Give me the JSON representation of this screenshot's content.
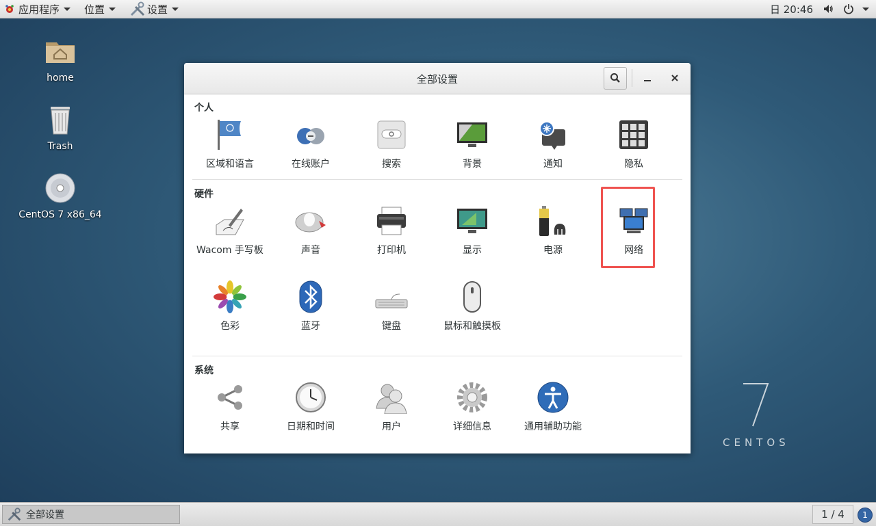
{
  "topbar": {
    "apps_label": "应用程序",
    "places_label": "位置",
    "settings_label": "设置",
    "clock": "日 20:46"
  },
  "desktop": {
    "icons": [
      {
        "label": "home"
      },
      {
        "label": "Trash"
      },
      {
        "label": "CentOS 7 x86_64"
      }
    ],
    "watermark_text": "CENTOS"
  },
  "window": {
    "title": "全部设置",
    "sections": {
      "personal": {
        "title": "个人",
        "items": [
          "区域和语言",
          "在线账户",
          "搜索",
          "背景",
          "通知",
          "隐私"
        ]
      },
      "hardware": {
        "title": "硬件",
        "items": [
          "Wacom 手写板",
          "声音",
          "打印机",
          "显示",
          "电源",
          "网络",
          "色彩",
          "蓝牙",
          "键盘",
          "鼠标和触摸板"
        ]
      },
      "system": {
        "title": "系统",
        "items": [
          "共享",
          "日期和时间",
          "用户",
          "详细信息",
          "通用辅助功能"
        ]
      }
    },
    "highlighted_item": "网络",
    "highlight_color": "#ef5350"
  },
  "bottombar": {
    "task_label": "全部设置",
    "workspace": "1 / 4",
    "notification_count": "1"
  }
}
